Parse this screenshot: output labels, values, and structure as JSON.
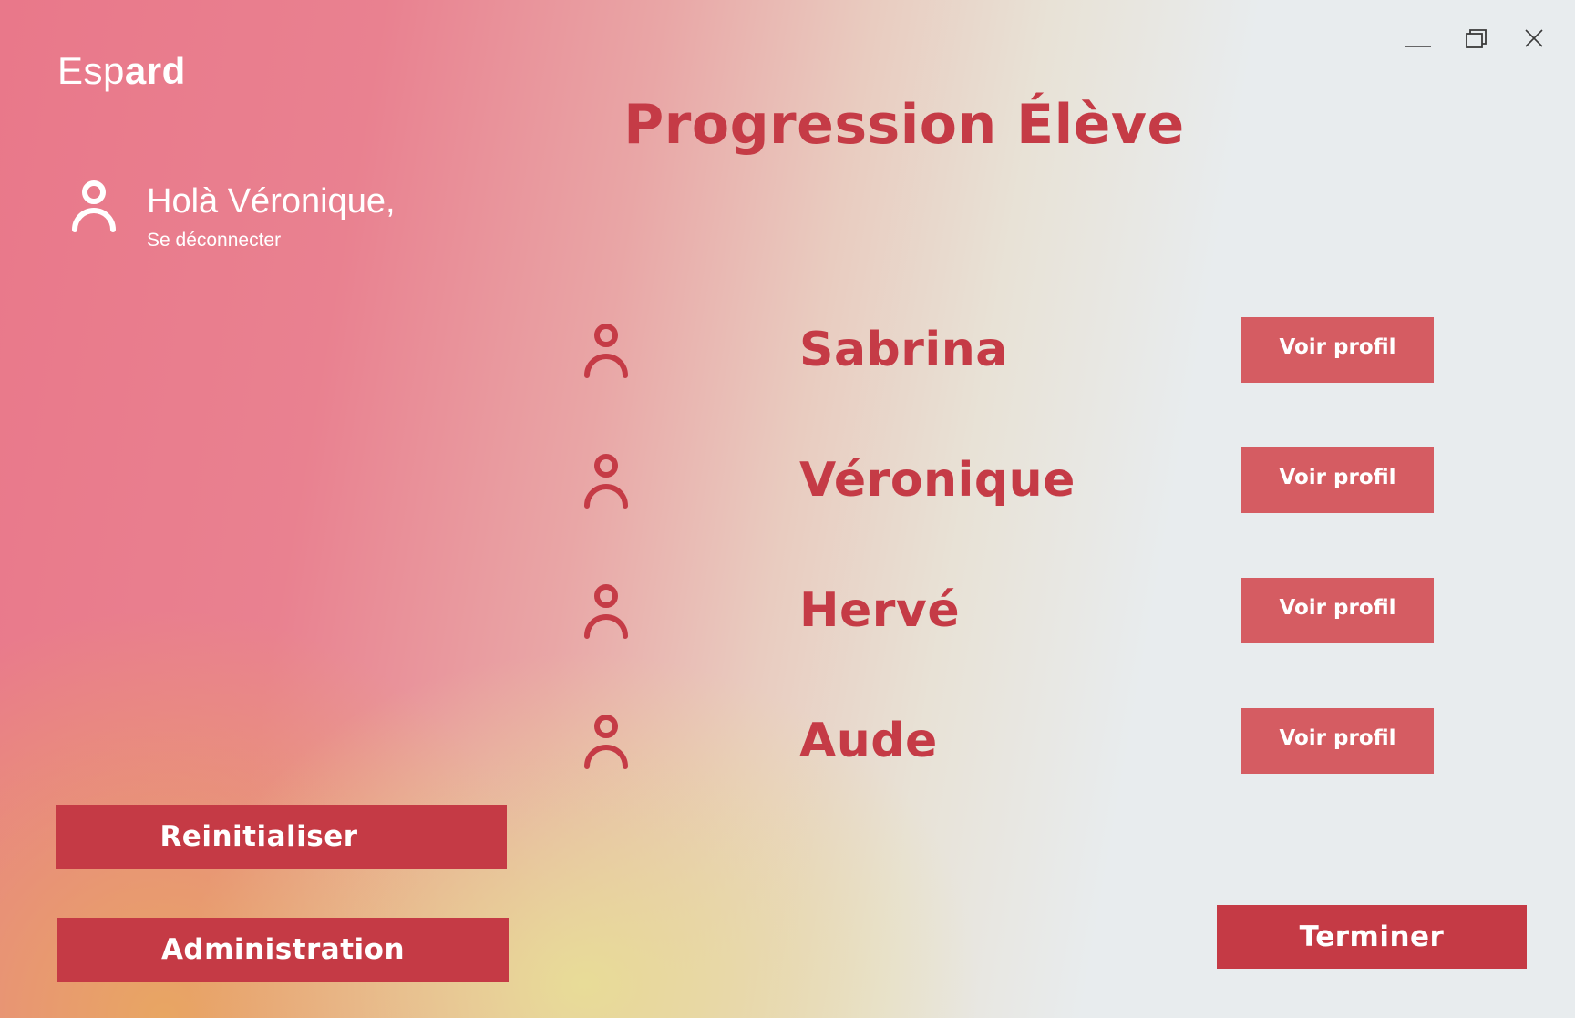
{
  "app": {
    "logo_light": "Esp",
    "logo_bold": "ard"
  },
  "window_controls": {
    "minimize_icon": "minimize-icon",
    "maximize_icon": "restore-icon",
    "close_icon": "close-icon"
  },
  "user": {
    "greeting": "Holà Véronique,",
    "logout_label": "Se déconnecter",
    "icon": "user-icon"
  },
  "main": {
    "title": "Progression Élève",
    "students": [
      {
        "name": "Sabrina",
        "button_label": "Voir profil"
      },
      {
        "name": "Véronique",
        "button_label": "Voir profil"
      },
      {
        "name": "Hervé",
        "button_label": "Voir profil"
      },
      {
        "name": "Aude",
        "button_label": "Voir profil"
      }
    ]
  },
  "actions": {
    "reset_label": "Reinitialiser",
    "admin_label": "Administration",
    "finish_label": "Terminer"
  },
  "colors": {
    "accent": "#c53b46",
    "button": "#c53a45",
    "button_light": "#d55c62",
    "gradient_pink": "#e9788a",
    "gradient_yellow": "#e8de96",
    "gradient_orange": "#e8a860",
    "background": "#e8ecee"
  }
}
